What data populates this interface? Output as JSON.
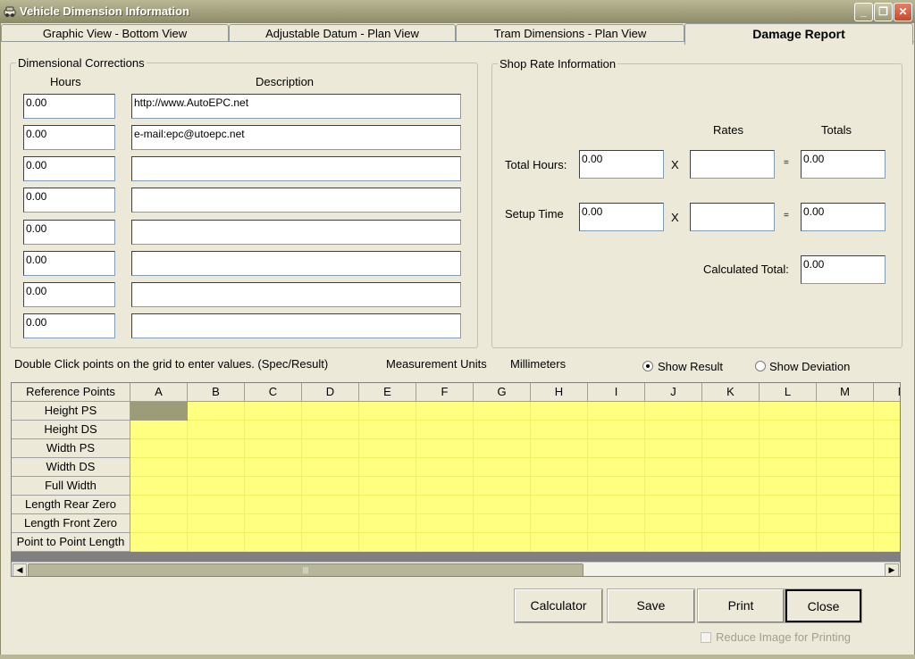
{
  "window": {
    "title": "Vehicle Dimension Information",
    "minimize": "_",
    "restore": "❐",
    "close": "✕"
  },
  "tabs": [
    {
      "label": "Graphic View - Bottom View"
    },
    {
      "label": "Adjustable Datum - Plan View"
    },
    {
      "label": "Tram Dimensions - Plan View"
    },
    {
      "label": "Damage Report"
    }
  ],
  "corrections": {
    "title": "Dimensional Corrections",
    "hours_header": "Hours",
    "desc_header": "Description",
    "rows": [
      {
        "hours": "0.00",
        "desc": "http://www.AutoEPC.net"
      },
      {
        "hours": "0.00",
        "desc": "e-mail:epc@utoepc.net"
      },
      {
        "hours": "0.00",
        "desc": ""
      },
      {
        "hours": "0.00",
        "desc": ""
      },
      {
        "hours": "0.00",
        "desc": ""
      },
      {
        "hours": "0.00",
        "desc": ""
      },
      {
        "hours": "0.00",
        "desc": ""
      },
      {
        "hours": "0.00",
        "desc": ""
      }
    ]
  },
  "shop_rate": {
    "title": "Shop Rate Information",
    "rates_header": "Rates",
    "totals_header": "Totals",
    "total_hours_label": "Total Hours:",
    "total_hours": "0.00",
    "total_hours_rate": "",
    "total_hours_total": "0.00",
    "setup_label": "Setup Time",
    "setup_time": "0.00",
    "setup_rate": "",
    "setup_total": "0.00",
    "times": "X",
    "equals": "=",
    "calculated_label": "Calculated Total:",
    "calculated_total": "0.00"
  },
  "grid_info": {
    "instruction": "Double Click points on the grid to enter values. (Spec/Result)",
    "units_label": "Measurement Units",
    "units_value": "Millimeters",
    "show_result": "Show Result",
    "show_deviation": "Show Deviation",
    "show_result_checked": true
  },
  "grid": {
    "corner": "Reference Points",
    "columns": [
      "A",
      "B",
      "C",
      "D",
      "E",
      "F",
      "G",
      "H",
      "I",
      "J",
      "K",
      "L",
      "M",
      "N"
    ],
    "rows": [
      "Height PS",
      "Height DS",
      "Width PS",
      "Width DS",
      "Full Width",
      "Length Rear Zero",
      "Length Front Zero",
      "Point to Point Length"
    ],
    "selected": {
      "row": 0,
      "col": 0
    },
    "scroll_left": "◀",
    "scroll_right": "▶",
    "scroll_grip": "|||"
  },
  "buttons": {
    "calculator": "Calculator",
    "save": "Save",
    "print": "Print",
    "close": "Close"
  },
  "reduce_image": {
    "label": "Reduce Image for Printing",
    "checked": false
  },
  "colors": {
    "grid_data": "#ffff80",
    "grid_selected": "#9c9c78",
    "titlebar": "#8d8b68"
  }
}
